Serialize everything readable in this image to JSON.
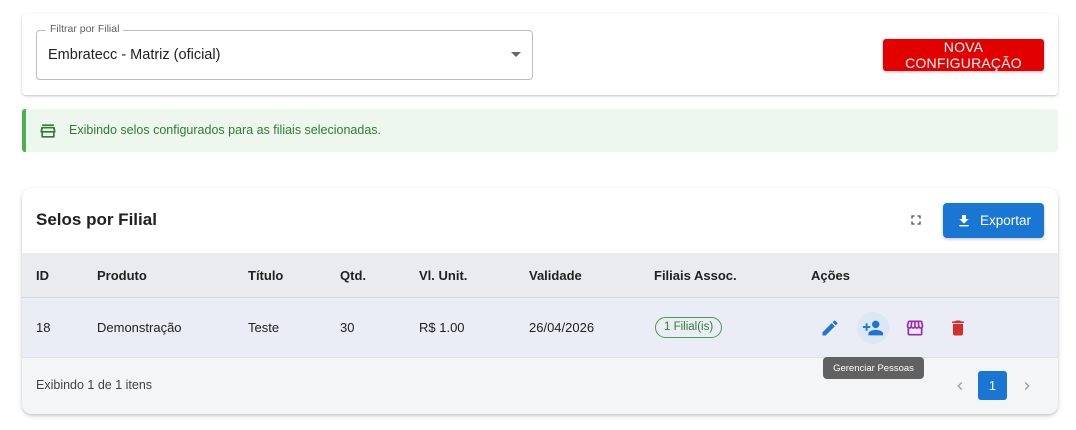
{
  "filter": {
    "label": "Filtrar por Filial",
    "selected": "Embratecc - Matriz (oficial)",
    "new_button": "NOVA CONFIGURAÇÃO"
  },
  "alert": {
    "icon": "store-icon",
    "text": "Exibindo selos configurados para as filiais selecionadas."
  },
  "table": {
    "title": "Selos por Filial",
    "export_label": "Exportar",
    "columns": [
      "ID",
      "Produto",
      "Título",
      "Qtd.",
      "Vl. Unit.",
      "Validade",
      "Filiais Assoc.",
      "Ações"
    ],
    "rows": [
      {
        "id": "18",
        "produto": "Demonstração",
        "titulo": "Teste",
        "qtd": "30",
        "vl_unit": "R$ 1.00",
        "validade": "26/04/2026",
        "filiais": "1 Filial(is)",
        "actions": [
          "edit-icon",
          "manage-people-icon",
          "store-icon",
          "delete-icon"
        ]
      }
    ],
    "footer_text": "Exibindo 1 de 1 itens",
    "current_page": "1"
  },
  "tooltip": "Gerenciar Pessoas",
  "colors": {
    "primary": "#1976d2",
    "danger": "#e20000",
    "success": "#2e7d32",
    "purple": "#9c27b0",
    "delete": "#d32f2f"
  }
}
